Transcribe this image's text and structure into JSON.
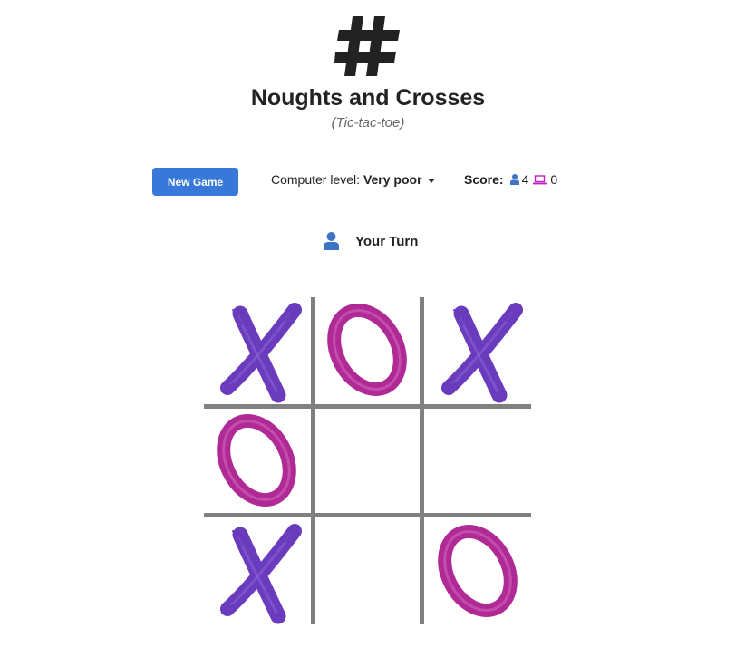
{
  "header": {
    "logo_icon": "hash-icon",
    "title": "Noughts and Crosses",
    "subtitle": "(Tic-tac-toe)"
  },
  "controls": {
    "new_game_label": "New Game",
    "level_label": "Computer level:",
    "level_value": "Very poor",
    "score_label": "Score:",
    "player_icon": "user-icon",
    "player_score": "4",
    "computer_icon": "laptop-icon",
    "computer_score": "0"
  },
  "status": {
    "icon": "user-icon",
    "text": "Your Turn"
  },
  "board": {
    "cells": [
      "X",
      "O",
      "X",
      "O",
      "",
      "",
      "X",
      "",
      "O"
    ]
  },
  "colors": {
    "accent": "#3878d8",
    "player": "#3d73c4",
    "computer": "#c020c0",
    "cross": "#6a3bbd",
    "nought": "#b02a96",
    "grid": "#808080"
  }
}
